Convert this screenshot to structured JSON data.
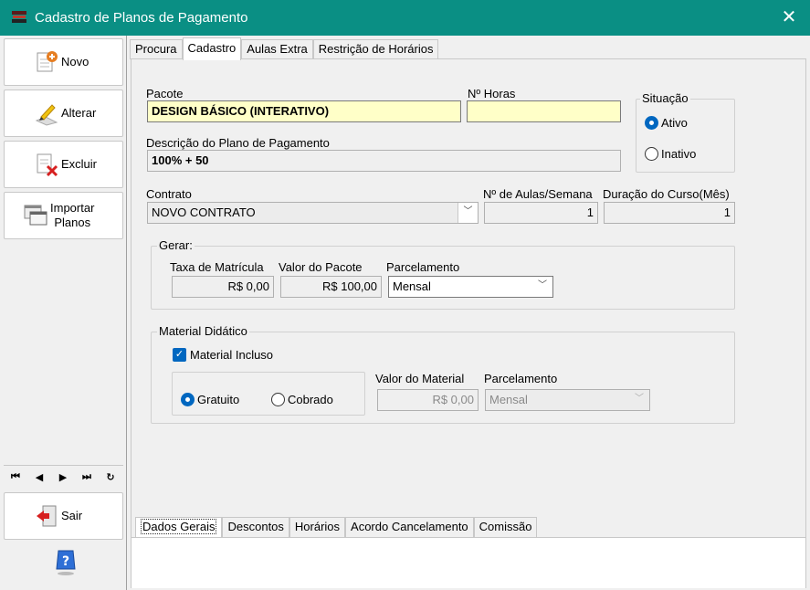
{
  "window": {
    "title": "Cadastro de Planos de Pagamento",
    "close_glyph": "✕"
  },
  "sidebar": {
    "novo": "Novo",
    "alterar": "Alterar",
    "excluir": "Excluir",
    "importar_line1": "Importar",
    "importar_line2": "Planos",
    "sair": "Sair",
    "nav": [
      "⏮",
      "◀",
      "▶",
      "⏭",
      "↻"
    ]
  },
  "tabs_top": [
    "Procura",
    "Cadastro",
    "Aulas Extra",
    "Restrição de Horários"
  ],
  "form": {
    "pacote_label": "Pacote",
    "pacote_value": "DESIGN BÁSICO (INTERATIVO)",
    "horas_label": "Nº Horas",
    "horas_value": "",
    "situacao_label": "Situação",
    "situacao_ativo": "Ativo",
    "situacao_inativo": "Inativo",
    "descricao_label": "Descrição do Plano de Pagamento",
    "descricao_value": "100% + 50",
    "contrato_label": "Contrato",
    "contrato_value": "NOVO CONTRATO",
    "aulas_label": "Nº de Aulas/Semana",
    "aulas_value": "1",
    "duracao_label": "Duração do Curso(Mês)",
    "duracao_value": "1",
    "gerar_title": "Gerar:",
    "taxa_label": "Taxa de Matrícula",
    "taxa_value": "R$ 0,00",
    "valor_pacote_label": "Valor do Pacote",
    "valor_pacote_value": "R$ 100,00",
    "parcelamento_label": "Parcelamento",
    "parcelamento_value": "Mensal",
    "material_title": "Material Didático",
    "material_incluso": "Material Incluso",
    "gratuito": "Gratuito",
    "cobrado": "Cobrado",
    "valor_material_label": "Valor do Material",
    "valor_material_value": "R$ 0,00",
    "parcelamento2_label": "Parcelamento",
    "parcelamento2_value": "Mensal"
  },
  "tabs_bottom": [
    "Dados Gerais",
    "Descontos",
    "Horários",
    "Acordo Cancelamento",
    "Comissão"
  ]
}
